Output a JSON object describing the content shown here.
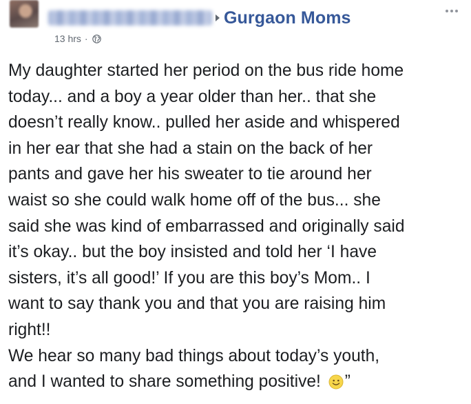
{
  "post": {
    "group_name": "Gurgaon Moms",
    "timestamp": "13 hrs",
    "separator": "·",
    "privacy_icon": "globe-icon",
    "more_icon": "more-options-icon",
    "lines": [
      "My daughter started her period on the bus ride home",
      "today... and a boy a year older than her.. that she",
      "doesn’t really know.. pulled her aside and whispered",
      "in her ear that she had a stain on the back of her",
      "pants and gave her his sweater to tie around her",
      "waist so she could walk home off of the bus... she",
      "said she was kind of embarrassed and originally said",
      "it’s okay.. but the boy insisted and told her ‘I have",
      "sisters, it’s all good!’ If you are this boy’s Mom.. I",
      "want to say thank you and that you are raising him",
      "right!!",
      "We hear so many bad things about today’s youth,"
    ],
    "last_line": "and I wanted to share something positive!",
    "closing_quote": "”",
    "emoji_icon": "smile-emoji-icon"
  },
  "colors": {
    "group_link": "#365899",
    "meta_text": "#606770",
    "body_text": "#1c1e21",
    "emoji_fill": "#f7d64a"
  }
}
